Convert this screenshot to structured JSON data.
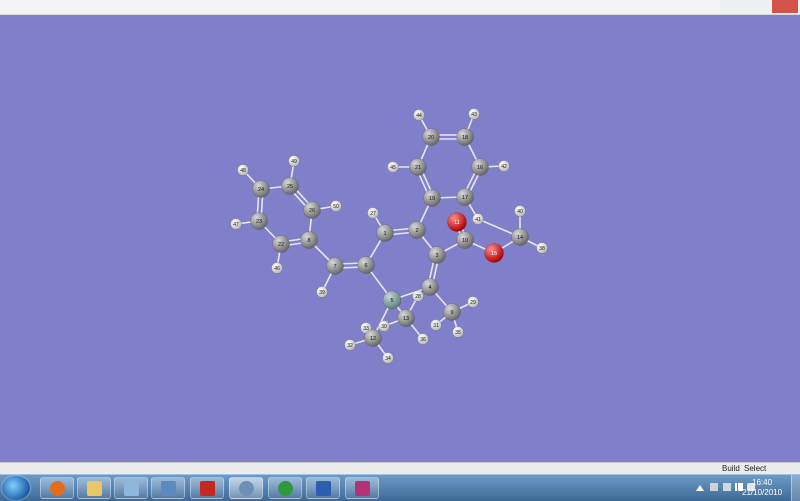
{
  "status_bar": {
    "build": "Build",
    "placement": "Select Placement"
  },
  "clock": {
    "time": "16:40",
    "date": "21/10/2010"
  },
  "taskbar": {
    "items": [
      {
        "name": "firefox-icon",
        "color": "#e36d1b"
      },
      {
        "name": "folder-icon",
        "color": "#e9c766"
      },
      {
        "name": "notepad-icon",
        "color": "#8fb7de"
      },
      {
        "name": "window-icon",
        "color": "#5a8ac0"
      },
      {
        "name": "acrobat-icon",
        "color": "#c6281f"
      },
      {
        "name": "molecule-app-icon",
        "color": "#6f8fb6"
      },
      {
        "name": "icd-app-icon",
        "color": "#2e9a3e"
      },
      {
        "name": "word-icon",
        "color": "#2d5db1"
      },
      {
        "name": "app-3d-icon",
        "color": "#b33474"
      }
    ]
  },
  "molecule": {
    "atoms": [
      {
        "id": "1",
        "el": "C"
      },
      {
        "id": "2",
        "el": "C"
      },
      {
        "id": "3",
        "el": "C"
      },
      {
        "id": "4",
        "el": "C"
      },
      {
        "id": "5",
        "el": "Si"
      },
      {
        "id": "6",
        "el": "C"
      },
      {
        "id": "7",
        "el": "C"
      },
      {
        "id": "8",
        "el": "C"
      },
      {
        "id": "9",
        "el": "C"
      },
      {
        "id": "10",
        "el": "C"
      },
      {
        "id": "11",
        "el": "O"
      },
      {
        "id": "12",
        "el": "C"
      },
      {
        "id": "13",
        "el": "C"
      },
      {
        "id": "14",
        "el": "C"
      },
      {
        "id": "15",
        "el": "O"
      },
      {
        "id": "16",
        "el": "C"
      },
      {
        "id": "17",
        "el": "C"
      },
      {
        "id": "18",
        "el": "C"
      },
      {
        "id": "19",
        "el": "C"
      },
      {
        "id": "20",
        "el": "C"
      },
      {
        "id": "21",
        "el": "C"
      },
      {
        "id": "22",
        "el": "C"
      },
      {
        "id": "23",
        "el": "C"
      },
      {
        "id": "24",
        "el": "C"
      },
      {
        "id": "25",
        "el": "C"
      },
      {
        "id": "26",
        "el": "C"
      },
      {
        "id": "27",
        "el": "H"
      },
      {
        "id": "28",
        "el": "H"
      },
      {
        "id": "29",
        "el": "H"
      },
      {
        "id": "30",
        "el": "H"
      },
      {
        "id": "31",
        "el": "H"
      },
      {
        "id": "32",
        "el": "H"
      },
      {
        "id": "33",
        "el": "H"
      },
      {
        "id": "34",
        "el": "H"
      },
      {
        "id": "35",
        "el": "H"
      },
      {
        "id": "36",
        "el": "H"
      },
      {
        "id": "37",
        "el": "H"
      },
      {
        "id": "38",
        "el": "H"
      },
      {
        "id": "39",
        "el": "H"
      },
      {
        "id": "40",
        "el": "H"
      },
      {
        "id": "41",
        "el": "H"
      },
      {
        "id": "42",
        "el": "H"
      },
      {
        "id": "43",
        "el": "H"
      },
      {
        "id": "44",
        "el": "H"
      },
      {
        "id": "45",
        "el": "H"
      },
      {
        "id": "46",
        "el": "H"
      },
      {
        "id": "47",
        "el": "H"
      },
      {
        "id": "48",
        "el": "H"
      },
      {
        "id": "49",
        "el": "H"
      },
      {
        "id": "50",
        "el": "H"
      }
    ],
    "colors": {
      "C": "#8c8c8c",
      "O": "#e02020",
      "Si": "#7f9d9c",
      "H": "#f2f2f2"
    }
  }
}
